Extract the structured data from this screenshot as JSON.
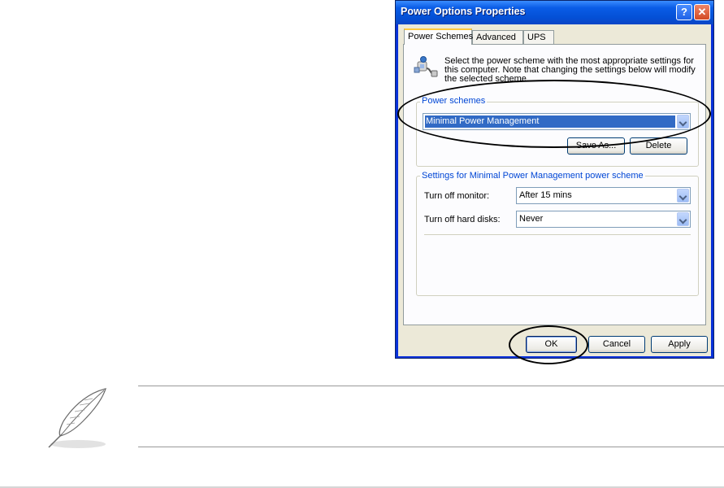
{
  "window": {
    "title": "Power Options Properties",
    "help_label": "?",
    "close_label": "✕"
  },
  "tabs": [
    {
      "label": "Power Schemes",
      "active": true
    },
    {
      "label": "Advanced",
      "active": false
    },
    {
      "label": "UPS",
      "active": false
    }
  ],
  "description": {
    "line1": "Select the power scheme with the most appropriate settings for",
    "line2": "this computer. Note that changing the settings below will modify",
    "line3": "the selected scheme."
  },
  "power_schemes": {
    "group_label": "Power schemes",
    "selected": "Minimal Power Management",
    "save_as_label": "Save As...",
    "delete_label": "Delete"
  },
  "settings": {
    "group_label": "Settings for Minimal Power Management power scheme",
    "monitor_label": "Turn off monitor:",
    "monitor_value": "After 15 mins",
    "disks_label": "Turn off hard disks:",
    "disks_value": "Never"
  },
  "buttons": {
    "ok": "OK",
    "cancel": "Cancel",
    "apply": "Apply"
  },
  "icons": {
    "power_icon": "power-plug-icon",
    "note_icon": "feather-quill-icon"
  },
  "colors": {
    "titlebar": "#0a5ce6",
    "selection": "#316ac5",
    "group_label": "#0046d5"
  }
}
